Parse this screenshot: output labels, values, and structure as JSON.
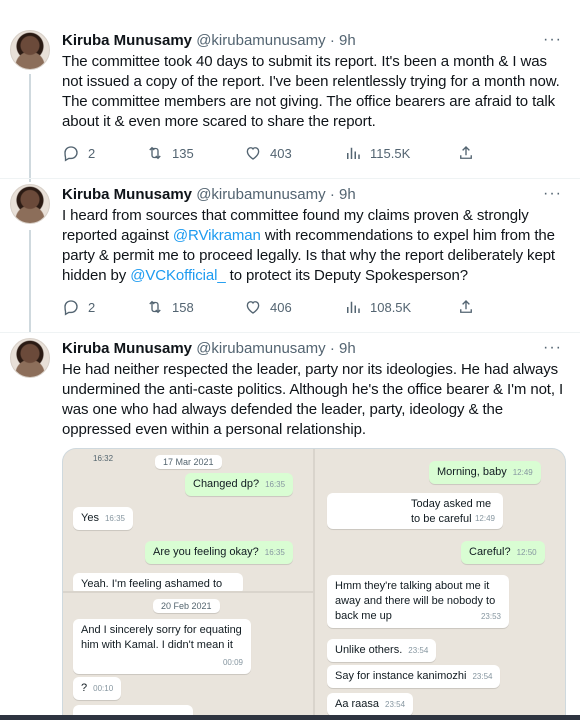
{
  "colors": {
    "accent": "#1d9bf0",
    "text": "#0f1419",
    "muted": "#536471",
    "chat_bg": "#e9e4dc",
    "chat_out": "#d9fdd3"
  },
  "tweets": [
    {
      "name": "Kiruba Munusamy",
      "handle": "@kirubamunusamy",
      "time": "· 9h",
      "more": "···",
      "text": "The committee took 40 days to submit its report. It's been a month & I was not issued a copy of the report. I've been relentlessly trying for a month now. The committee members are not giving. The office bearers are afraid to talk about it & even more scared to share the report.",
      "replies": "2",
      "retweets": "135",
      "likes": "403",
      "views": "115.5K"
    },
    {
      "name": "Kiruba Munusamy",
      "handle": "@kirubamunusamy",
      "time": "· 9h",
      "more": "···",
      "text_parts": [
        "I heard from sources that committee found my claims proven & strongly reported against ",
        "@RVikraman",
        " with recommendations to expel him from the party & permit me to proceed legally. Is that why the report deliberately kept hidden by ",
        "@VCKofficial_",
        " to protect its Deputy Spokesperson?"
      ],
      "replies": "2",
      "retweets": "158",
      "likes": "406",
      "views": "108.5K"
    },
    {
      "name": "Kiruba Munusamy",
      "handle": "@kirubamunusamy",
      "time": "· 9h",
      "more": "···",
      "text": "He had neither respected the leader, party nor its ideologies. He had always undermined the anti-caste politics. Although he's the office bearer & I'm not, I was one who had always defended the leader, party, ideology & the oppressed even within a personal relationship."
    }
  ],
  "chat": {
    "left_top": {
      "time_top": "16:32",
      "date": "17 Mar 2021",
      "messages": [
        {
          "dir": "out",
          "text": "Changed dp?",
          "time": "16:35"
        },
        {
          "dir": "in",
          "text": "Yes",
          "time": "16:35"
        },
        {
          "dir": "out",
          "text": "Are you feeling okay?",
          "time": "16:35"
        },
        {
          "dir": "in",
          "text": "Yeah. I'm feeling ashamed to be",
          "time": ""
        }
      ]
    },
    "left_bottom": {
      "date": "20 Feb 2021",
      "messages": [
        {
          "dir": "in",
          "text": "And I sincerely sorry for equating him with Kamal. I didn't mean it",
          "time": "00:09"
        },
        {
          "dir": "in",
          "text": "?",
          "time": "00:10"
        }
      ]
    },
    "right": {
      "messages": [
        {
          "dir": "out",
          "text": "Morning, baby",
          "time": "12:49"
        },
        {
          "dir": "in",
          "text": "Today asked me to be careful",
          "time": "12:49"
        },
        {
          "dir": "out",
          "text": "Careful?",
          "time": "12:50"
        },
        {
          "dir": "in",
          "text": "Hmm they're talking about me it away and there will be nobody to back me up",
          "time": "23:53"
        },
        {
          "dir": "in",
          "text": "Unlike others.",
          "time": "23:54"
        },
        {
          "dir": "in",
          "text": "Say for instance kanimozhi",
          "time": "23:54"
        },
        {
          "dir": "in",
          "text": "Aa raasa",
          "time": "23:54"
        }
      ]
    }
  }
}
